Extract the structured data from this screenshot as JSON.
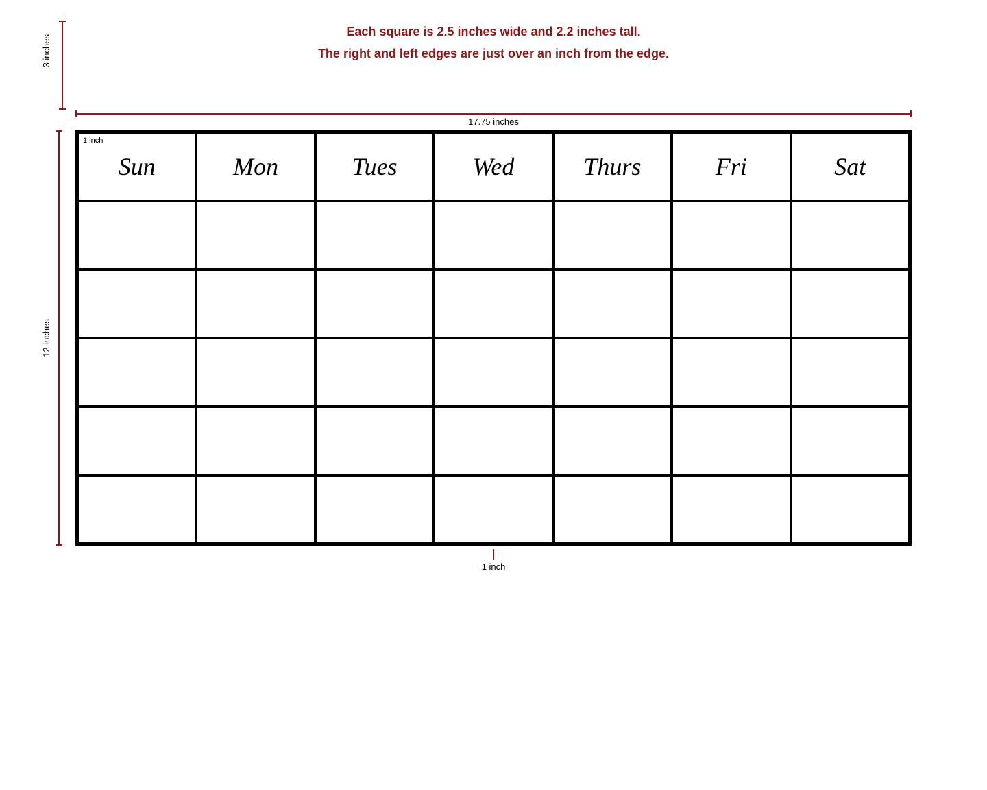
{
  "annotations": {
    "top_line1": "Each square is 2.5 inches wide and 2.2 inches tall.",
    "top_line2": "The right and left edges are just over an inch from the edge.",
    "horizontal_label": "17.75 inches",
    "vertical_3in_label": "3 inches",
    "vertical_12in_label": "12 inches",
    "bottom_label": "1 inch",
    "inch_corner_label": "1 inch"
  },
  "days": [
    {
      "id": "sun",
      "label": "Sun"
    },
    {
      "id": "mon",
      "label": "Mon"
    },
    {
      "id": "tue",
      "label": "Tues"
    },
    {
      "id": "wed",
      "label": "Wed"
    },
    {
      "id": "thu",
      "label": "Thurs"
    },
    {
      "id": "fri",
      "label": "Fri"
    },
    {
      "id": "sat",
      "label": "Sat"
    }
  ],
  "rows": 5,
  "colors": {
    "dark_red": "#8B1A1A",
    "black": "#000000",
    "white": "#ffffff"
  }
}
